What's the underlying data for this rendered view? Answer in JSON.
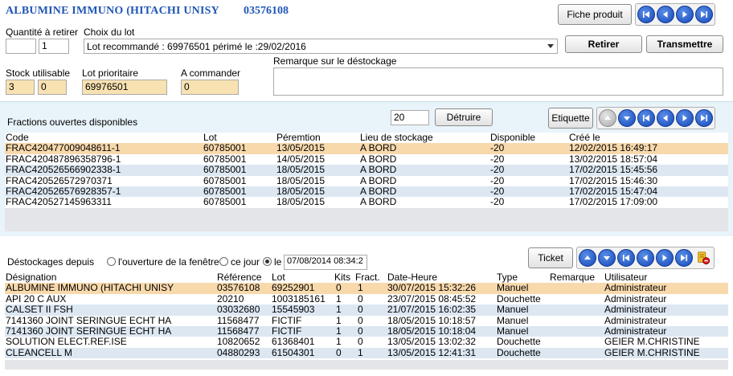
{
  "header": {
    "title": "ALBUMINE IMMUNO (HITACHI UNISY",
    "code": "03576108",
    "fiche_label": "Fiche produit"
  },
  "form": {
    "qty_label": "Quantité à retirer",
    "qty_value1": "",
    "qty_value2": "1",
    "lot_label": "Choix du lot",
    "lot_selected": "Lot recommandé : 69976501 périmé le :29/02/2016",
    "retirer_label": "Retirer",
    "transmettre_label": "Transmettre",
    "stock_label": "Stock utilisable",
    "stock_value1": "3",
    "stock_value2": "0",
    "lot_prio_label": "Lot prioritaire",
    "lot_prio_value": "69976501",
    "commander_label": "A commander",
    "commander_value": "0",
    "remarque_label": "Remarque sur le déstockage"
  },
  "fractions": {
    "title": "Fractions ouvertes disponibles",
    "count_value": "20",
    "detruire_label": "Détruire",
    "etiquette_label": "Etiquette",
    "columns": [
      "Code",
      "Lot",
      "Péremtion",
      "Lieu de stockage",
      "Disponible",
      "Créé le"
    ],
    "rows": [
      [
        "FRAC420477009048611-1",
        "60785001",
        "13/05/2015",
        "A BORD",
        "-20",
        "12/02/2015 16:49:17"
      ],
      [
        "FRAC420487896358796-1",
        "60785001",
        "14/05/2015",
        "A BORD",
        "-20",
        "13/02/2015 18:57:04"
      ],
      [
        "FRAC420526566902338-1",
        "60785001",
        "18/05/2015",
        "A BORD",
        "-20",
        "17/02/2015 15:45:56"
      ],
      [
        "FRAC420526572970371",
        "60785001",
        "18/05/2015",
        "A BORD",
        "-20",
        "17/02/2015 15:46:30"
      ],
      [
        "FRAC420526576928357-1",
        "60785001",
        "18/05/2015",
        "A BORD",
        "-20",
        "17/02/2015 15:47:04"
      ],
      [
        "FRAC420527145963311",
        "60785001",
        "18/05/2015",
        "A BORD",
        "-20",
        "17/02/2015 17:09:00"
      ]
    ]
  },
  "destockages": {
    "label": "Déstockages depuis",
    "opt1": "l'ouverture de la fenêtre",
    "opt2": "ce jour",
    "opt3": "le",
    "date_value": "07/08/2014 08:34:2",
    "ticket_label": "Ticket",
    "columns": [
      "Désignation",
      "Référence",
      "Lot",
      "Kits",
      "Fract.",
      "Date-Heure",
      "Type",
      "Remarque",
      "Utilisateur"
    ],
    "rows": [
      [
        "ALBUMINE IMMUNO (HITACHI UNISY",
        "03576108",
        "69252901",
        "0",
        "1",
        "30/07/2015 15:32:26",
        "Manuel",
        "",
        "Administrateur"
      ],
      [
        "API 20 C AUX",
        "20210",
        "1003185161",
        "1",
        "0",
        "23/07/2015 08:45:52",
        "Douchette",
        "",
        "Administrateur"
      ],
      [
        "CALSET II FSH",
        "03032680",
        "15545903",
        "1",
        "0",
        "21/07/2015 16:02:35",
        "Manuel",
        "",
        "Administrateur"
      ],
      [
        "7141360 JOINT SERINGUE ECHT HA",
        "11568477",
        "FICTIF",
        "1",
        "0",
        "18/05/2015 10:18:57",
        "Manuel",
        "",
        "Administrateur"
      ],
      [
        "7141360 JOINT SERINGUE ECHT HA",
        "11568477",
        "FICTIF",
        "1",
        "0",
        "18/05/2015 10:18:04",
        "Manuel",
        "",
        "Administrateur"
      ],
      [
        "SOLUTION ELECT.REF.ISE",
        "10820652",
        "61368401",
        "1",
        "0",
        "13/05/2015 13:02:32",
        "Douchette",
        "",
        "GEIER M.CHRISTINE"
      ],
      [
        "CLEANCELL M",
        "04880293",
        "61504301",
        "0",
        "1",
        "13/05/2015 12:41:31",
        "Douchette",
        "",
        "GEIER M.CHRISTINE"
      ]
    ]
  }
}
